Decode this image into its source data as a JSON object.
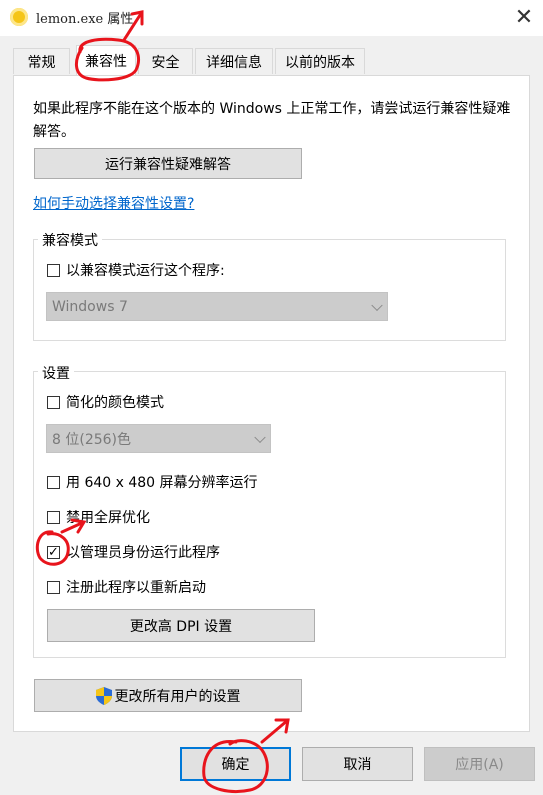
{
  "window": {
    "title": "lemon.exe 属性",
    "close_glyph": "✕"
  },
  "tabs": [
    {
      "label": "常规"
    },
    {
      "label": "兼容性"
    },
    {
      "label": "安全"
    },
    {
      "label": "详细信息"
    },
    {
      "label": "以前的版本"
    }
  ],
  "compat": {
    "description": "如果此程序不能在这个版本的 Windows 上正常工作，请尝试运行兼容性疑难解答。",
    "troubleshoot_button": "运行兼容性疑难解答",
    "manual_link": "如何手动选择兼容性设置?",
    "mode_group": {
      "label": "兼容模式",
      "checkbox": "以兼容模式运行这个程序:",
      "os_select": "Windows 7"
    },
    "settings_group": {
      "label": "设置",
      "reduced_color": "简化的颜色模式",
      "color_select": "8 位(256)色",
      "res_640": "用 640 x 480 屏幕分辨率运行",
      "disable_fullscreen": "禁用全屏优化",
      "run_as_admin": "以管理员身份运行此程序",
      "run_as_admin_checked": true,
      "register_restart": "注册此程序以重新启动",
      "dpi_button": "更改高 DPI 设置"
    },
    "all_users_button": "更改所有用户的设置"
  },
  "footer": {
    "ok": "确定",
    "cancel": "取消",
    "apply": "应用(A)"
  },
  "colors": {
    "accent": "#0078d7",
    "annotation": "#e8141c",
    "link": "#0066cc"
  }
}
